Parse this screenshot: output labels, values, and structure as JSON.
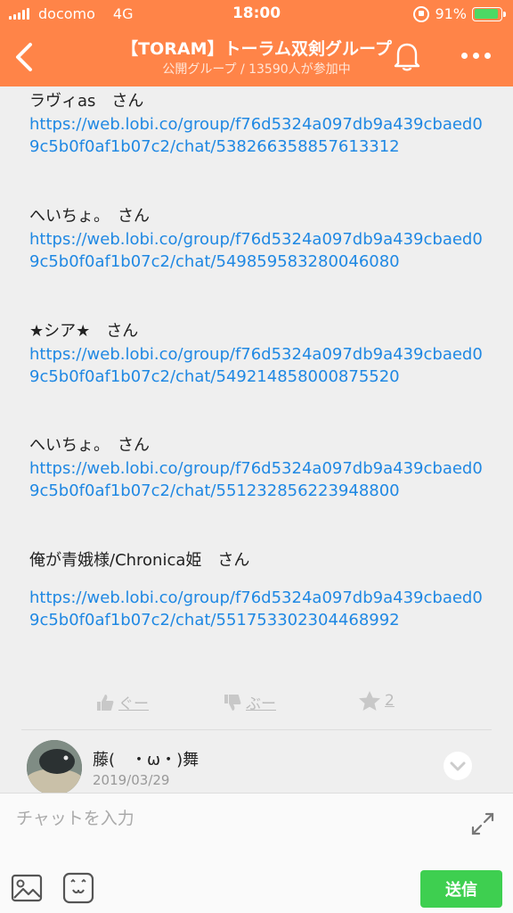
{
  "status": {
    "carrier": "docomo",
    "network": "4G",
    "time": "18:00",
    "battery": "91%",
    "battery_level": 0.91
  },
  "header": {
    "title": "【TORAM】トーラム双剣グループ",
    "subtitle": "公開グループ / 13590人が参加中"
  },
  "entries": [
    {
      "name": "ラヴィas　さん",
      "link": "https://web.lobi.co/group/f76d5324a097db9a439cbaed09c5b0f0af1b07c2/chat/538266358857613312"
    },
    {
      "name": "へいちょ。　さん",
      "link": "https://web.lobi.co/group/f76d5324a097db9a439cbaed09c5b0f0af1b07c2/chat/549859583280046080"
    },
    {
      "name": "★シア★　さん",
      "link": "https://web.lobi.co/group/f76d5324a097db9a439cbaed09c5b0f0af1b07c2/chat/549214858000875520"
    },
    {
      "name": "へいちょ。　さん",
      "link": "https://web.lobi.co/group/f76d5324a097db9a439cbaed09c5b0f0af1b07c2/chat/551232856223948800"
    },
    {
      "name": "俺が青娥様/Chronica姫　さん",
      "link": "https://web.lobi.co/group/f76d5324a097db9a439cbaed09c5b0f0af1b07c2/chat/551753302304468992"
    }
  ],
  "reactions": {
    "good_label": "ぐー",
    "boo_label": "ぶー",
    "star_count": "2"
  },
  "comment": {
    "author": "藤(　・ω・)舞",
    "date": "2019/03/29"
  },
  "input": {
    "placeholder": "チャットを入力",
    "send_label": "送信"
  },
  "colors": {
    "header_bg": "#ff8448",
    "link": "#1f88e3",
    "send_button": "#3ecf50",
    "battery": "#4cd964"
  }
}
